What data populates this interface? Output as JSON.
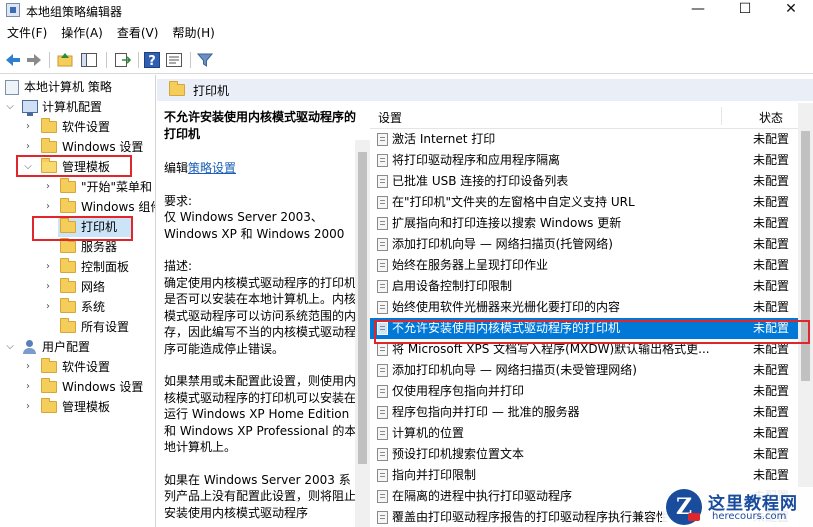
{
  "window": {
    "title": "本地组策略编辑器",
    "minimize": "—",
    "maximize": "☐",
    "close": "✕"
  },
  "menu": [
    "文件(F)",
    "操作(A)",
    "查看(V)",
    "帮助(H)"
  ],
  "tree": {
    "root": "本地计算机 策略",
    "computer": "计算机配置",
    "computer_children": {
      "software": "软件设置",
      "windows": "Windows 设置",
      "admin": "管理模板",
      "admin_children": {
        "start": "\"开始\"菜单和",
        "components": "Windows 组件",
        "printers": "打印机",
        "servers": "服务器",
        "control_panel": "控制面板",
        "network": "网络",
        "system": "系统",
        "all": "所有设置"
      }
    },
    "user": "用户配置",
    "user_children": {
      "software": "软件设置",
      "windows": "Windows 设置",
      "admin": "管理模板"
    }
  },
  "pane": {
    "title": "打印机"
  },
  "description": {
    "title": "不允许安装使用内核模式驱动程序的打印机",
    "edit_prefix": "编辑",
    "edit_link": "策略设置",
    "req_label": "要求:",
    "req_text": "仅 Windows Server 2003、Windows XP 和 Windows 2000",
    "desc_label": "描述:",
    "desc_text": "确定使用内核模式驱动程序的打印机是否可以安装在本地计算机上。内核模式驱动程序可以访问系统范围的内存，因此编写不当的内核模式驱动程序可能造成停止错误。",
    "para2": "如果禁用或未配置此设置，则使用内核模式驱动程序的打印机可以安装在运行 Windows XP Home Edition 和 Windows XP Professional 的本地计算机上。",
    "para3": "如果在 Windows Server 2003 系列产品上没有配置此设置，则将阻止安装使用内核模式驱动程序"
  },
  "list": {
    "col_setting": "设置",
    "col_state": "状态",
    "rows": [
      {
        "name": "激活 Internet 打印",
        "state": "未配置"
      },
      {
        "name": "将打印驱动程序和应用程序隔离",
        "state": "未配置"
      },
      {
        "name": "已批准 USB 连接的打印设备列表",
        "state": "未配置"
      },
      {
        "name": "在\"打印机\"文件夹的左窗格中自定义支持 URL",
        "state": "未配置"
      },
      {
        "name": "扩展指向和打印连接以搜索 Windows 更新",
        "state": "未配置"
      },
      {
        "name": "添加打印机向导 — 网络扫描页(托管网络)",
        "state": "未配置"
      },
      {
        "name": "始终在服务器上呈现打印作业",
        "state": "未配置"
      },
      {
        "name": "启用设备控制打印限制",
        "state": "未配置"
      },
      {
        "name": "始终使用软件光栅器来光栅化要打印的内容",
        "state": "未配置"
      },
      {
        "name": "不允许安装使用内核模式驱动程序的打印机",
        "state": "未配置"
      },
      {
        "name": "将 Microsoft XPS 文档写入程序(MXDW)默认输出格式更...",
        "state": "未配置"
      },
      {
        "name": "添加打印机向导 — 网络扫描页(未受管理网络)",
        "state": "未配置"
      },
      {
        "name": "仅使用程序包指向并打印",
        "state": "未配置"
      },
      {
        "name": "程序包指向并打印 — 批准的服务器",
        "state": "未配置"
      },
      {
        "name": "计算机的位置",
        "state": "未配置"
      },
      {
        "name": "预设打印机搜索位置文本",
        "state": "未配置"
      },
      {
        "name": "指向并打印限制",
        "state": "未配置"
      },
      {
        "name": "在隔离的进程中执行打印驱动程序",
        "state": "未配置"
      },
      {
        "name": "覆盖由打印驱动程序报告的打印驱动程序执行兼容性",
        "state": "未配置"
      }
    ]
  },
  "watermark": {
    "logo": "Z",
    "name": "这里教程网",
    "url": "herecours.com"
  },
  "colors": {
    "selection": "#0078d7",
    "highlight_box": "#e0262a",
    "header_bg": "#e9eef7"
  },
  "icons": {
    "back": "back-arrow-icon",
    "forward": "forward-arrow-icon",
    "up": "up-folder-icon",
    "show_hide": "show-hide-tree-icon",
    "export": "export-list-icon",
    "help": "help-icon",
    "properties": "properties-icon",
    "filter": "filter-icon"
  }
}
